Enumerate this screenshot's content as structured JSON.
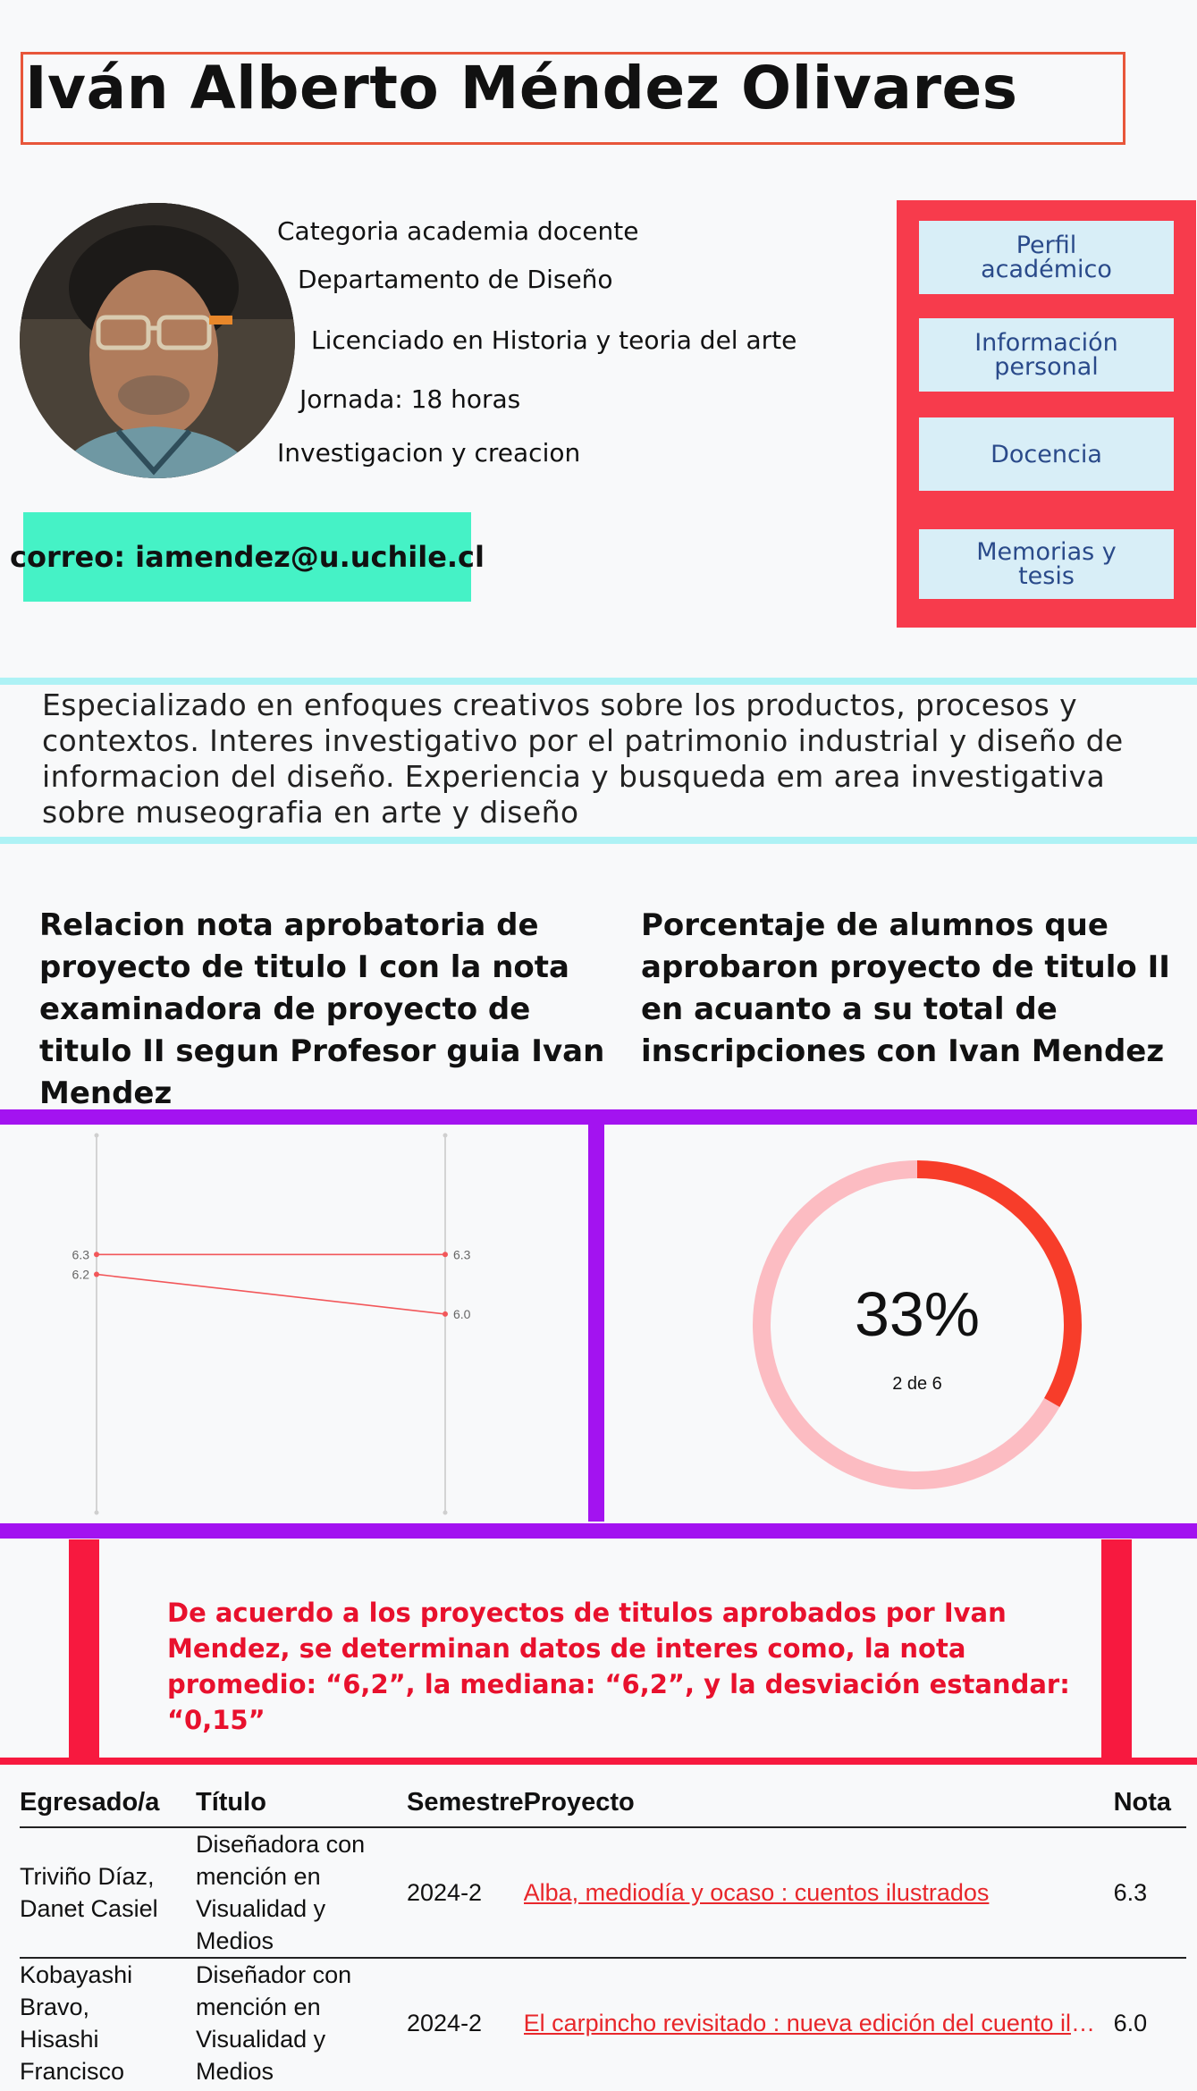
{
  "header": {
    "name": "Iván Alberto Méndez Olivares"
  },
  "profile": {
    "lines": [
      "Categoria academia docente",
      "Departamento de Diseño",
      "Licenciado en Historia y teoria del arte",
      "Jornada: 18 horas",
      "Investigacion y creacion"
    ],
    "email": "correo: iamendez@u.uchile.cl"
  },
  "nav": {
    "perfil": "Perfil académico",
    "personal": "Información personal",
    "docencia": "Docencia",
    "memorias": "Memorias y tesis"
  },
  "bio": "Especializado en enfoques creativos sobre los productos, procesos y contextos. Interes investigativo por el patrimonio industrial y diseño de informacion del diseño. Experiencia y busqueda em area investigativa sobre museografia en arte y diseño",
  "charts": {
    "left_title": "Relacion nota aprobatoria de proyecto de titulo I con la nota examinadora de proyecto de titulo II segun Profesor guia Ivan Mendez",
    "right_title": "Porcentaje de alumnos que aprobaron proyecto de titulo II en acuanto a su total de inscripciones con Ivan Mendez",
    "donut_percent": "33%",
    "donut_sub": "2 de 6"
  },
  "chart_data": [
    {
      "type": "line",
      "title": "Relacion nota aprobatoria de proyecto de titulo I con la nota examinadora de proyecto de titulo II segun Profesor guia Ivan Mendez",
      "series": [
        {
          "values": [
            6.3,
            6.3
          ]
        },
        {
          "values": [
            6.2,
            6.0
          ]
        }
      ],
      "start_labels": [
        "6.3",
        "6.2"
      ],
      "end_labels": [
        "6.3",
        "6.0"
      ],
      "ylim": [
        5.0,
        6.9
      ],
      "color": "#f2575a"
    },
    {
      "type": "pie",
      "title": "Porcentaje de alumnos que aprobaron proyecto de titulo II en acuanto a su total de inscripciones con Ivan Mendez",
      "values": [
        2,
        4
      ],
      "colors": [
        "#f73d2a",
        "#fcbcc2"
      ],
      "center_label": "33%",
      "center_sub": "2 de 6"
    }
  ],
  "summary": "De acuerdo a los proyectos de titulos aprobados por Ivan Mendez, se determinan datos de interes como, la nota promedio: “6,2”, la mediana: “6,2”, y la desviación estandar: “0,15”",
  "table": {
    "headers": [
      "Egresado/a",
      "Título",
      "Semestre",
      "Proyecto",
      "Nota"
    ],
    "rows": [
      {
        "egresado": [
          "Triviño Díaz,",
          "Danet Casiel"
        ],
        "titulo": [
          "Diseñadora con",
          "mención en",
          "Visualidad y Medios"
        ],
        "semestre": "2024-2",
        "proyecto": "Alba, mediodía y ocaso : cuentos ilustrados",
        "nota": "6.3"
      },
      {
        "egresado": [
          "Kobayashi Bravo,",
          "Hisashi Francisco"
        ],
        "titulo": [
          "Diseñador con",
          "mención en",
          "Visualidad y Medios"
        ],
        "semestre": "2024-2",
        "proyecto": "El carpincho revisitado : nueva edición del cuento ilustrad...",
        "nota": "6.0"
      }
    ]
  },
  "colors": {
    "accent_red": "#f73b4c",
    "purple": "#a313f0",
    "teal": "#45f2c6",
    "cyan": "#aef2f5"
  }
}
